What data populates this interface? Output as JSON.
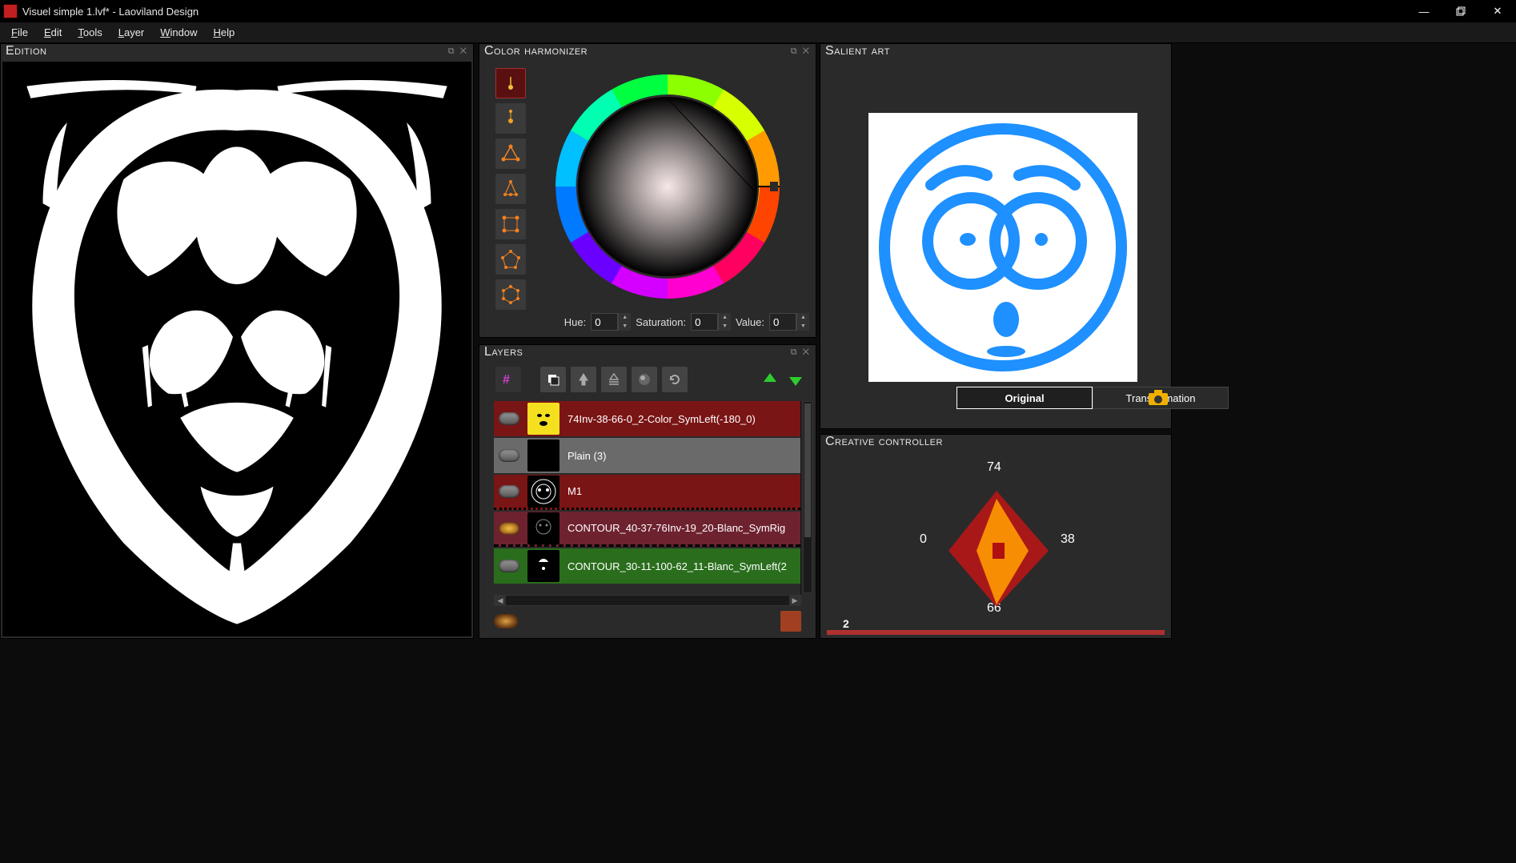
{
  "window": {
    "title": "Visuel simple 1.lvf* - Laoviland Design"
  },
  "menu": {
    "items": [
      "File",
      "Edit",
      "Tools",
      "Layer",
      "Window",
      "Help"
    ]
  },
  "panels": {
    "edition": {
      "title": "Edition"
    },
    "harmonizer": {
      "title": "Color harmonizer",
      "hue_label": "Hue:",
      "hue_value": "0",
      "sat_label": "Saturation:",
      "sat_value": "0",
      "val_label": "Value:",
      "val_value": "0",
      "modes": [
        "single",
        "complementary",
        "triad",
        "split",
        "square",
        "pentagon",
        "hexagon"
      ],
      "selected_mode": 0
    },
    "layers": {
      "title": "Layers",
      "items": [
        {
          "name": "74Inv-38-66-0_2-Color_SymLeft(-180_0)",
          "color": "red",
          "icon": "yellow-face"
        },
        {
          "name": "Plain (3)",
          "color": "gray",
          "icon": "plain"
        },
        {
          "name": "M1",
          "color": "red",
          "icon": "m1-art"
        },
        {
          "name": "CONTOUR_40-37-76Inv-19_20-Blanc_SymRig",
          "color": "dred",
          "icon": "contour1"
        },
        {
          "name": "CONTOUR_30-11-100-62_11-Blanc_SymLeft(2",
          "color": "green",
          "icon": "contour2"
        }
      ]
    },
    "salient": {
      "title": "Salient art",
      "tabs": {
        "original": "Original",
        "transformation": "Transformation",
        "active": "original"
      }
    },
    "creative": {
      "title": "Creative controller",
      "top": "74",
      "right": "38",
      "bottom": "66",
      "left": "0",
      "slider_value": "2"
    }
  }
}
